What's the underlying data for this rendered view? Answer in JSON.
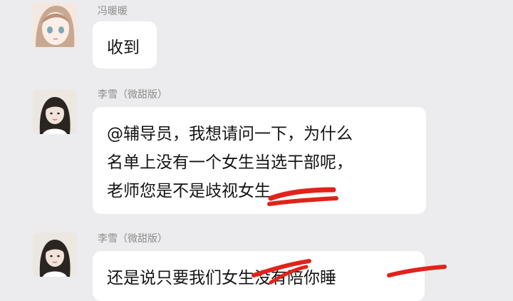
{
  "messages": [
    {
      "sender": "冯暖暖",
      "lines": [
        "收到"
      ],
      "avatar_icon": "anime-girl-avatar-icon"
    },
    {
      "sender": "李雪（微甜版）",
      "lines": [
        "@辅导员，我想请问一下，为什么",
        "名单上没有一个女生当选干部呢，",
        "老师您是不是歧视女生"
      ],
      "avatar_icon": "girl-photo-avatar-icon"
    },
    {
      "sender": "李雪（微甜版）",
      "lines": [
        "还是说只要我们女生没有陪你睡"
      ],
      "avatar_icon": "girl-photo-avatar-icon"
    }
  ],
  "colors": {
    "background": "#ececee",
    "bubble": "#ffffff",
    "strike": "#e0231b"
  }
}
